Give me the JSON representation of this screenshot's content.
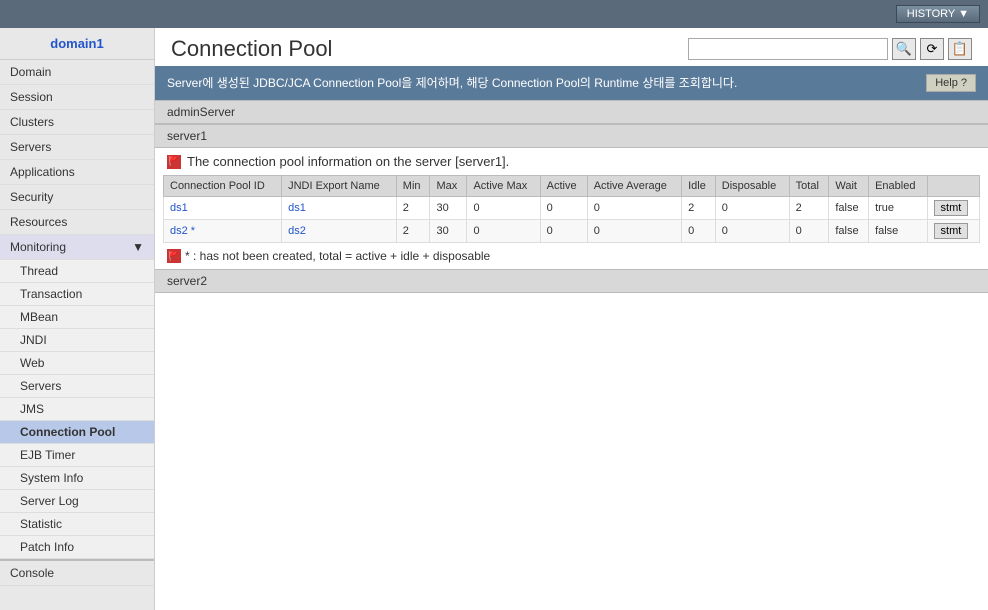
{
  "topbar": {
    "history_label": "HISTORY ▼"
  },
  "sidebar": {
    "domain_label": "domain1",
    "items": [
      {
        "label": "Domain",
        "name": "domain"
      },
      {
        "label": "Session",
        "name": "session"
      },
      {
        "label": "Clusters",
        "name": "clusters"
      },
      {
        "label": "Servers",
        "name": "servers"
      },
      {
        "label": "Applications",
        "name": "applications"
      },
      {
        "label": "Security",
        "name": "security"
      },
      {
        "label": "Resources",
        "name": "resources"
      }
    ],
    "monitoring_label": "Monitoring",
    "sub_items": [
      {
        "label": "Thread",
        "name": "thread"
      },
      {
        "label": "Transaction",
        "name": "transaction"
      },
      {
        "label": "MBean",
        "name": "mbean"
      },
      {
        "label": "JNDI",
        "name": "jndi"
      },
      {
        "label": "Web",
        "name": "web"
      },
      {
        "label": "Servers",
        "name": "servers-mon"
      },
      {
        "label": "JMS",
        "name": "jms"
      },
      {
        "label": "Connection Pool",
        "name": "connection-pool",
        "active": true
      },
      {
        "label": "EJB Timer",
        "name": "ejb-timer"
      },
      {
        "label": "System Info",
        "name": "system-info"
      },
      {
        "label": "Server Log",
        "name": "server-log"
      },
      {
        "label": "Statistic",
        "name": "statistic"
      },
      {
        "label": "Patch Info",
        "name": "patch-info"
      }
    ],
    "console_label": "Console"
  },
  "page": {
    "title": "Connection Pool",
    "search_placeholder": "",
    "info_text": "Server에 생성된 JDBC/JCA Connection Pool을 제어하며, 해당 Connection Pool의 Runtime 상태를 조회합니다.",
    "help_label": "Help ?"
  },
  "servers": [
    {
      "name": "adminServer",
      "show_table": false,
      "pools": []
    },
    {
      "name": "server1",
      "show_table": true,
      "section_title": "The connection pool information on the server [server1].",
      "columns": [
        "Connection Pool ID",
        "JNDI Export Name",
        "Min",
        "Max",
        "Active Max",
        "Active",
        "Active Average",
        "Idle",
        "Disposable",
        "Total",
        "Wait",
        "Enabled"
      ],
      "rows": [
        {
          "pool_id": "ds1",
          "jndi": "ds1",
          "min": "2",
          "max": "30",
          "active_max": "0",
          "active": "0",
          "active_avg": "0",
          "idle": "2",
          "disposable": "0",
          "total": "2",
          "wait": "false",
          "enabled": "true",
          "has_star": false
        },
        {
          "pool_id": "ds2 *",
          "jndi": "ds2",
          "min": "2",
          "max": "30",
          "active_max": "0",
          "active": "0",
          "active_avg": "0",
          "idle": "0",
          "disposable": "0",
          "total": "0",
          "wait": "false",
          "enabled": "false",
          "has_star": true
        }
      ],
      "note": "* : has not been created, total = active + idle + disposable",
      "stmt_label": "stmt"
    },
    {
      "name": "server2",
      "show_table": false,
      "pools": []
    }
  ],
  "icons": {
    "search": "🔍",
    "refresh": "⟳",
    "export": "📋",
    "chevron": "▼",
    "flag": "🚩"
  }
}
